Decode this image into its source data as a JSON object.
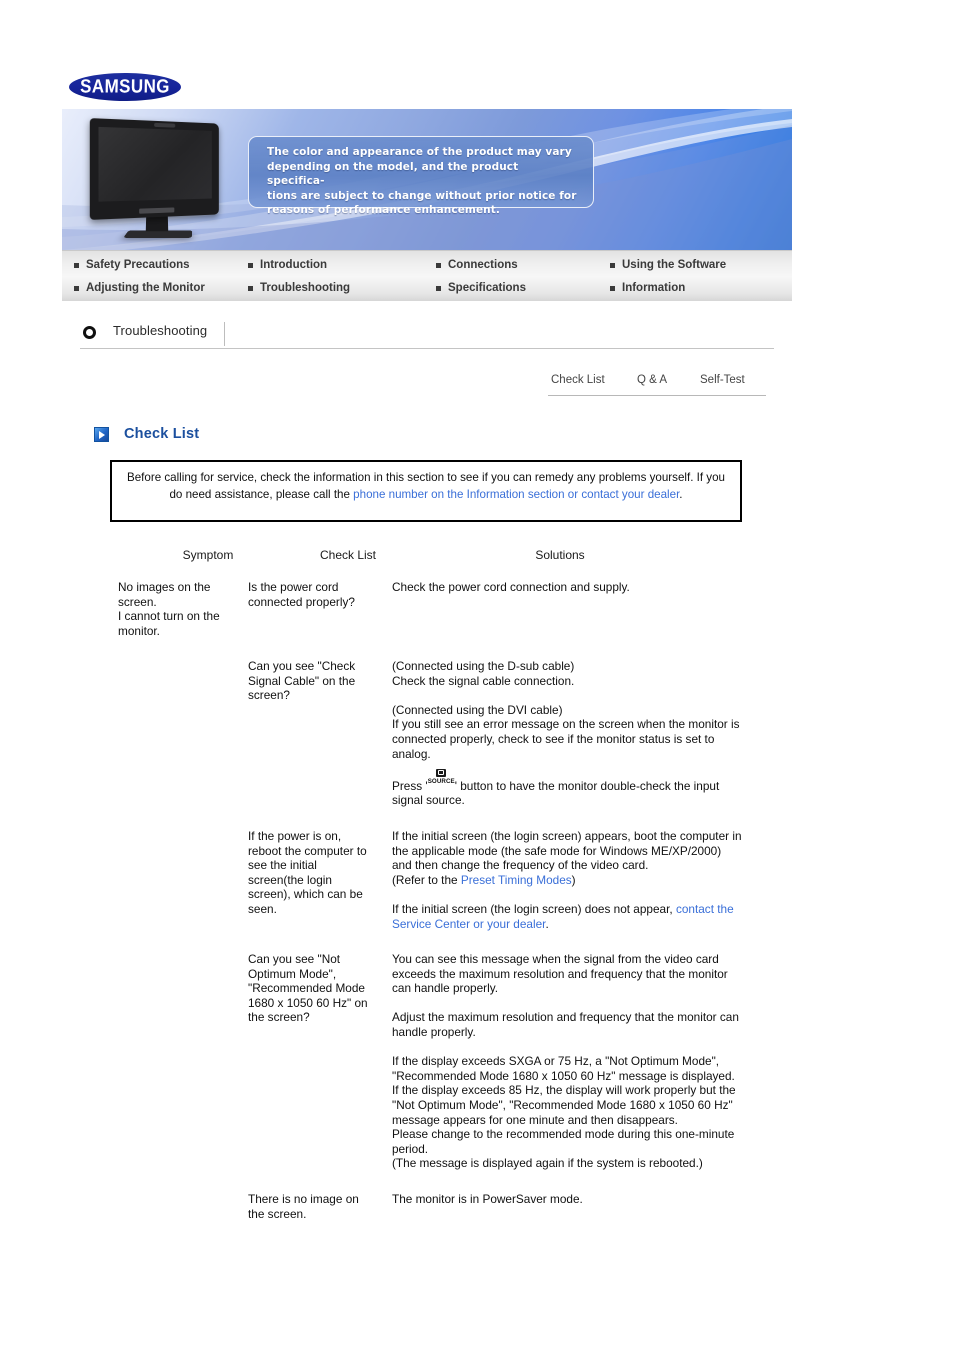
{
  "brand": {
    "logo_text": "SAMSUNG"
  },
  "banner": {
    "notice_lines": [
      "The color and appearance of the product may vary",
      "depending on the model, and the product specifica-",
      "tions are subject to change without prior notice for",
      "reasons of performance enhancement."
    ]
  },
  "nav": {
    "row1": [
      {
        "label": "Safety Precautions"
      },
      {
        "label": "Introduction"
      },
      {
        "label": "Connections"
      },
      {
        "label": "Using the Software"
      }
    ],
    "row2": [
      {
        "label": "Adjusting the Monitor"
      },
      {
        "label": "Troubleshooting"
      },
      {
        "label": "Specifications"
      },
      {
        "label": "Information"
      }
    ]
  },
  "section": {
    "title": "Troubleshooting"
  },
  "subtabs": [
    {
      "label": "Check List"
    },
    {
      "label": "Q & A"
    },
    {
      "label": "Self-Test"
    }
  ],
  "page_title": "Check List",
  "notice": {
    "part1": "Before calling for service, check the information in this section to see if you can remedy any problems yourself. If you do need assistance, please call the ",
    "link": "phone number on the Information section or contact your dealer",
    "part2": "."
  },
  "table": {
    "headers": {
      "symptom": "Symptom",
      "check_list": "Check List",
      "solutions": "Solutions"
    },
    "rows": [
      {
        "symptom": "No images on the screen.\nI cannot turn on the monitor.",
        "check": "Is the power cord connected properly?",
        "solution_blocks": [
          {
            "text": "Check the power cord connection and supply."
          }
        ]
      },
      {
        "symptom": "",
        "check": "Can you see \"Check Signal Cable\" on the screen?",
        "solution_blocks": [
          {
            "text": "(Connected using the D-sub cable)\nCheck the signal cable connection."
          },
          {
            "text": "(Connected using the DVI cable)\nIf you still see an error message on the screen when the monitor is connected properly, check to see if the monitor status is set to analog."
          },
          {
            "special": "source-button",
            "before": "Press '",
            "button_label": "SOURCE",
            "after": "' button to have the monitor double-check the input signal source."
          }
        ]
      },
      {
        "symptom": "",
        "check": "If the power is on, reboot the computer to see the initial screen(the login screen), which can be seen.",
        "solution_blocks": [
          {
            "text": "If the initial screen (the login screen) appears, boot the computer in the applicable mode (the safe mode for Windows ME/XP/2000) and then change the frequency of the video card."
          },
          {
            "link_line": {
              "before": "(Refer to the ",
              "link": "Preset Timing Modes",
              "after": ")"
            },
            "nogap": true
          },
          {
            "link_line": {
              "before": "If the initial screen (the login screen) does not appear, ",
              "link": "contact the Service Center or your dealer",
              "after": "."
            }
          }
        ]
      },
      {
        "symptom": "",
        "check": "Can you see \"Not Optimum Mode\", \"Recommended Mode 1680 x 1050 60 Hz\" on the screen?",
        "solution_blocks": [
          {
            "text": "You can see this message when the signal from the video card exceeds the maximum resolution and frequency that the monitor can handle properly."
          },
          {
            "text": "Adjust the maximum resolution and frequency that the monitor can handle properly."
          },
          {
            "text": "If the display exceeds SXGA or 75 Hz, a \"Not Optimum Mode\", \"Recommended Mode 1680 x 1050 60 Hz\" message is displayed. If the display exceeds 85 Hz, the display will work properly but the \"Not Optimum Mode\", \"Recommended Mode 1680 x 1050 60 Hz\" message appears for one minute and then disappears.\nPlease change to the recommended mode during this one-minute period.\n(The message is displayed again if the system is rebooted.)"
          }
        ]
      },
      {
        "symptom": "",
        "check": "There is no image on the screen.",
        "solution_blocks": [
          {
            "text": "The monitor is in PowerSaver mode."
          }
        ]
      }
    ]
  },
  "colors": {
    "link": "#3a6fd8",
    "title": "#1b4f9e",
    "samsung_blue": "#1428a0"
  }
}
